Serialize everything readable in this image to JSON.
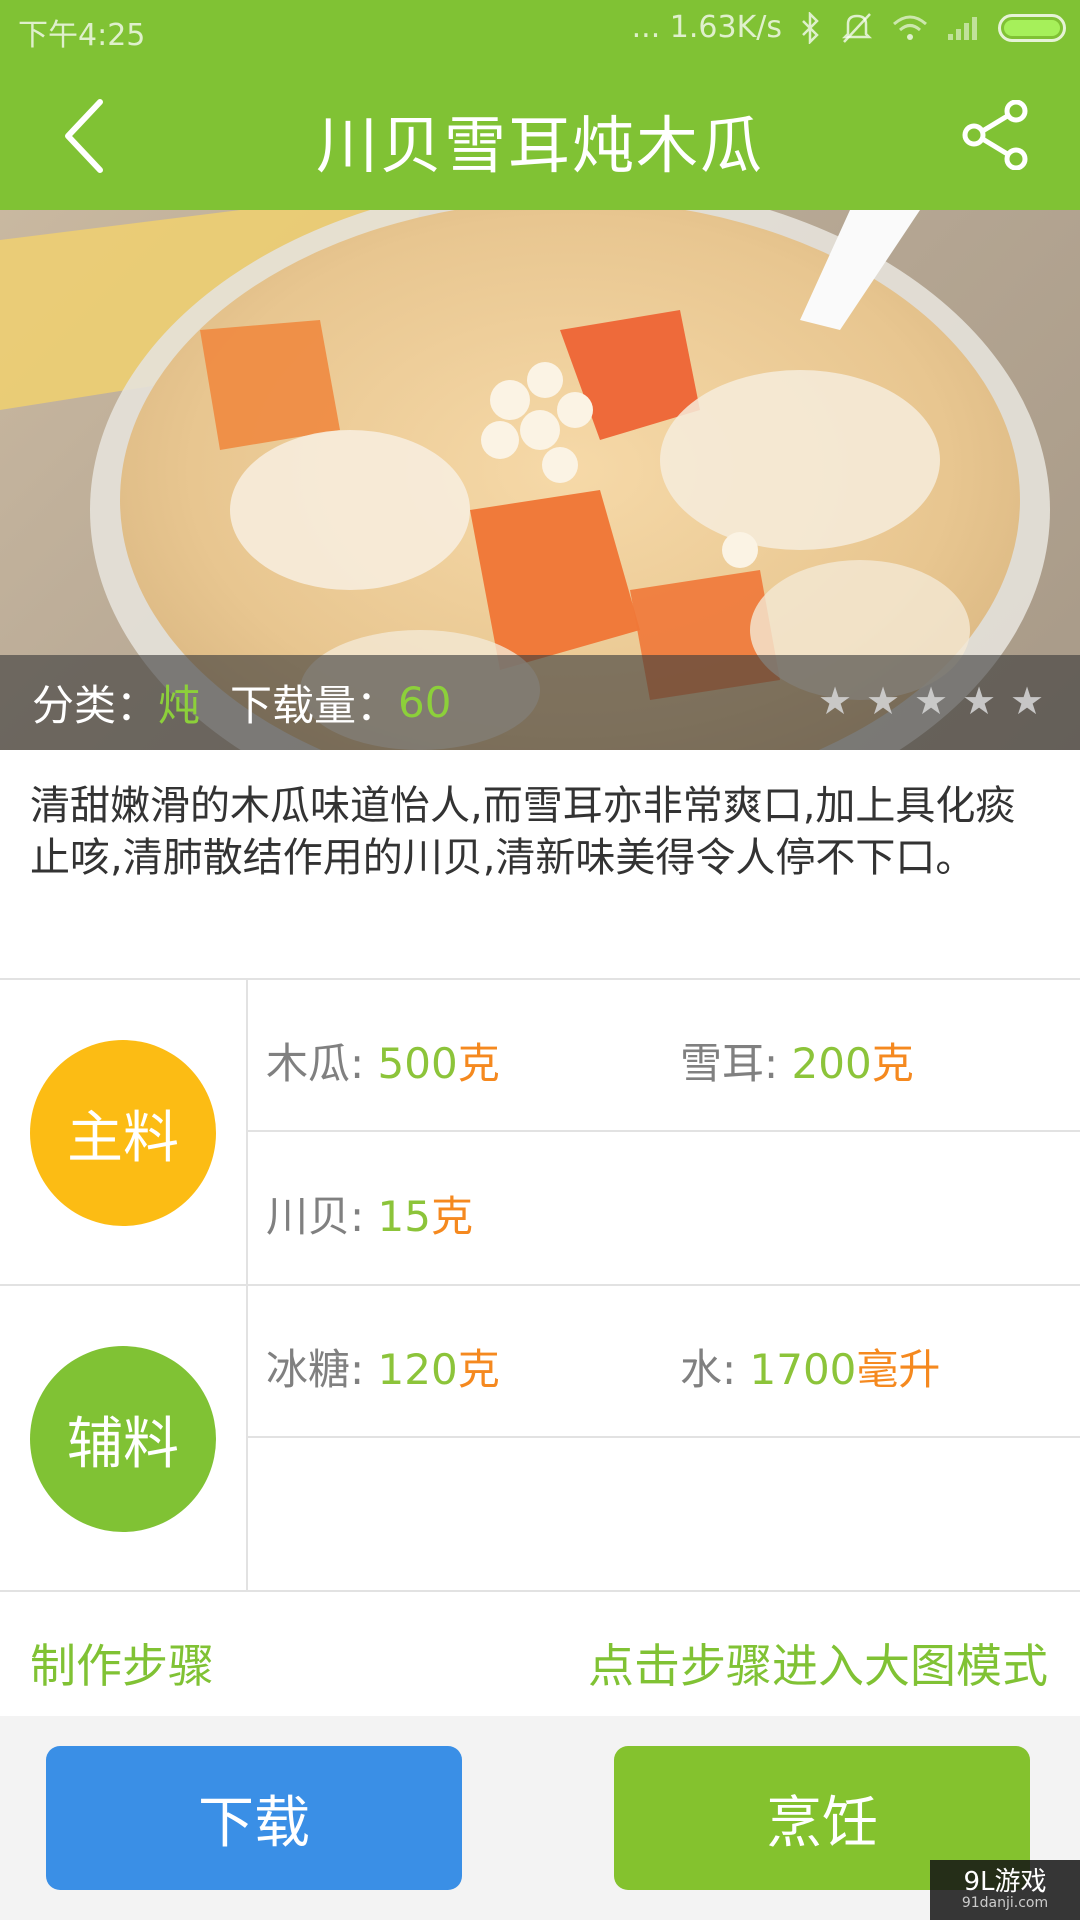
{
  "status_bar": {
    "time": "下午4:25",
    "speed": "... 1.63K/s"
  },
  "header": {
    "title": "川贝雪耳炖木瓜",
    "back_icon": "back-arrow-icon",
    "share_icon": "share-icon"
  },
  "hero": {
    "category_label": "分类：",
    "category_value": "炖",
    "downloads_label": "下载量：",
    "downloads_value": "60",
    "rating": 0,
    "rating_max": 5
  },
  "description": "清甜嫩滑的木瓜味道怡人,而雪耳亦非常爽口,加上具化痰止咳,清肺散结作用的川贝,清新味美得令人停不下口。",
  "ingredients": {
    "main": {
      "label": "主料",
      "color": "#fcbc14",
      "items": [
        {
          "name": "木瓜: ",
          "amount": "500",
          "unit": "克"
        },
        {
          "name": "雪耳: ",
          "amount": "200",
          "unit": "克"
        },
        {
          "name": "川贝: ",
          "amount": "15",
          "unit": "克"
        }
      ]
    },
    "aux": {
      "label": "辅料",
      "color": "#80c234",
      "items": [
        {
          "name": "冰糖: ",
          "amount": "120",
          "unit": "克"
        },
        {
          "name": "水: ",
          "amount": "1700",
          "unit": "毫升"
        }
      ]
    }
  },
  "steps": {
    "title": "制作步骤",
    "hint": "点击步骤进入大图模式"
  },
  "buttons": {
    "download": "下载",
    "cook": "烹饪"
  },
  "watermark": {
    "brand": "9L游戏",
    "site": "91danji.com"
  },
  "colors": {
    "primary_green": "#80c234",
    "orange": "#f5891f",
    "blue": "#3a8fe6"
  }
}
